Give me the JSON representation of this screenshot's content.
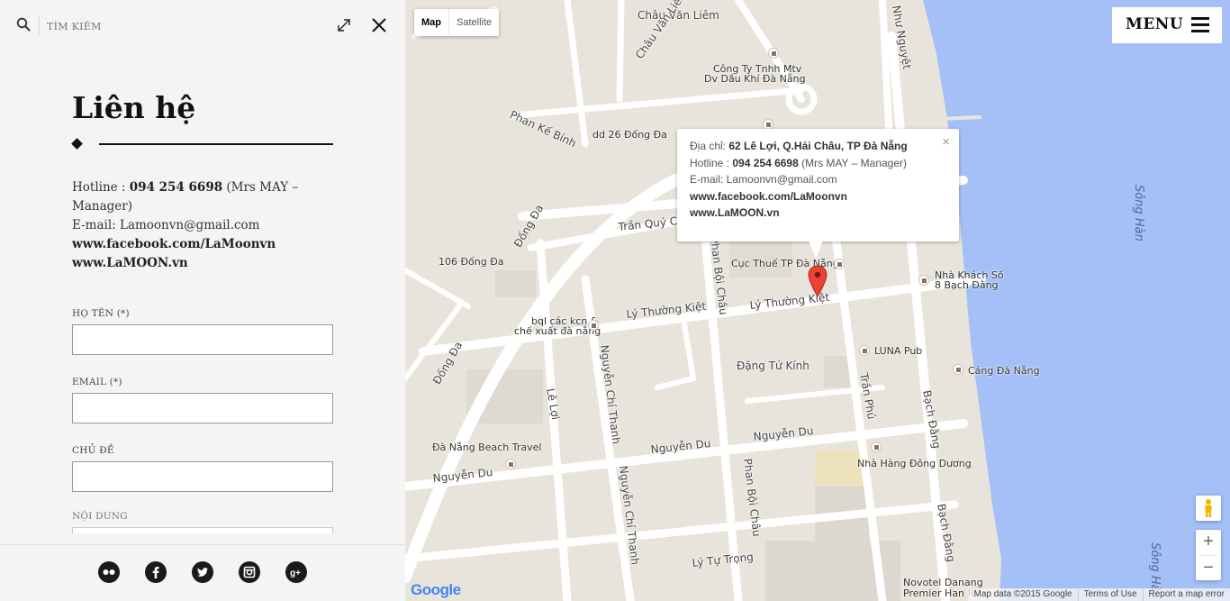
{
  "search": {
    "placeholder": "TÌM KIẾM"
  },
  "page": {
    "title": "Liên hệ"
  },
  "contact": {
    "hotline_label": "Hotline : ",
    "hotline_number": "094 254 6698",
    "hotline_note": " (Mrs MAY – Manager)",
    "email_line": "E-mail: Lamoonvn@gmail.com",
    "facebook": "www.facebook.com/LaMoonvn",
    "website": "www.LaMOON.vn"
  },
  "form": {
    "name_label": "HỌ TÊN (*)",
    "email_label": "EMAIL (*)",
    "subject_label": "CHỦ ĐỀ",
    "message_label": "NỘI DUNG"
  },
  "social": [
    {
      "name": "flickr-icon"
    },
    {
      "name": "facebook-icon"
    },
    {
      "name": "twitter-icon"
    },
    {
      "name": "instagram-icon"
    },
    {
      "name": "google-plus-icon"
    }
  ],
  "map": {
    "type_map": "Map",
    "type_satellite": "Satellite",
    "menu_label": "MENU",
    "zoom_in": "+",
    "zoom_out": "−",
    "info": {
      "address_label": "Địa chỉ: ",
      "address": "62 Lê Lợi, Q.Hải Châu, TP Đà Nẵng",
      "hotline_label": "Hotline : ",
      "hotline_number": "094 254 6698",
      "hotline_note": " (Mrs MAY – Manager)",
      "email": "E-mail: Lamoonvn@gmail.com",
      "facebook": "www.facebook.com/LaMoonvn",
      "website": "www.LaMOON.vn",
      "close": "×"
    },
    "labels": {
      "chau_van_liem_top": "Châu Văn Liêm",
      "chau_van_liem_diag": "Châu Văn Liêm",
      "nhu_nguyet": "Như Nguyệt",
      "cong_ty_1": "Công Ty Tnhh Mtv",
      "cong_ty_2": "Dv Dầu Khí Đà Nẵng",
      "phan_ke_binh": "Phan Kế Bính",
      "dd26": "dd 26 Đống Đa",
      "tran_quy_cap": "Trần Quý Cáp",
      "dd106": "106 Đống Đa",
      "dong_da_1": "Đống Đa",
      "dong_da_2": "Đống Đa",
      "cuc_thue": "Cục Thuế TP Đà Nẵng",
      "nha_khach_1": "Nhà Khách Số",
      "nha_khach_2": "8 Bạch Đằng",
      "ly_thuong_kiet_1": "Lý Thường Kiệt",
      "ly_thuong_kiet_2": "Lý Thường Kiệt",
      "bql_1": "bql các kcn &",
      "bql_2": "chế xuất đà nẵng",
      "luna_pub": "LUNA Pub",
      "cang_da_nang": "Cảng Đà Nẵng",
      "dang_tu_kinh": "Đặng Tử Kính",
      "le_loi": "Lê Lợi",
      "nguyen_chi_thanh_1": "Nguyễn Chí Thanh",
      "nguyen_chi_thanh_2": "Nguyễn Chí Thanh",
      "tran_phu": "Trần Phú",
      "bach_dang_1": "Bạch Đằng",
      "bach_dang_2": "Bạch Đằng",
      "da_nang_beach": "Đà Nẵng Beach Travel",
      "nguyen_du_1": "Nguyễn Du",
      "nguyen_du_2": "Nguyễn Du",
      "nguyen_du_3": "Nguyễn Du",
      "nha_hang": "Nhà Hàng Đông Dương",
      "phan_boi_chau_1": "Phan Bội Châu",
      "phan_boi_chau_2": "Phan Bội Châu",
      "ly_tu_trong": "Lý Tự Trọng",
      "novotel_1": "Novotel Danang",
      "novotel_2": "Premier Han Ri",
      "song_han_1": "Sông Hàn",
      "song_han_2": "Sông Hàn"
    },
    "attribution": {
      "data": "Map data ©2015 Google",
      "terms": "Terms of Use",
      "report": "Report a map error"
    },
    "google": "Google"
  },
  "colors": {
    "water": "#a5c0f7",
    "land": "#e8e4dc",
    "road": "#ffffff",
    "pin": "#ea4335",
    "panel_bg": "#f4f4f4"
  }
}
